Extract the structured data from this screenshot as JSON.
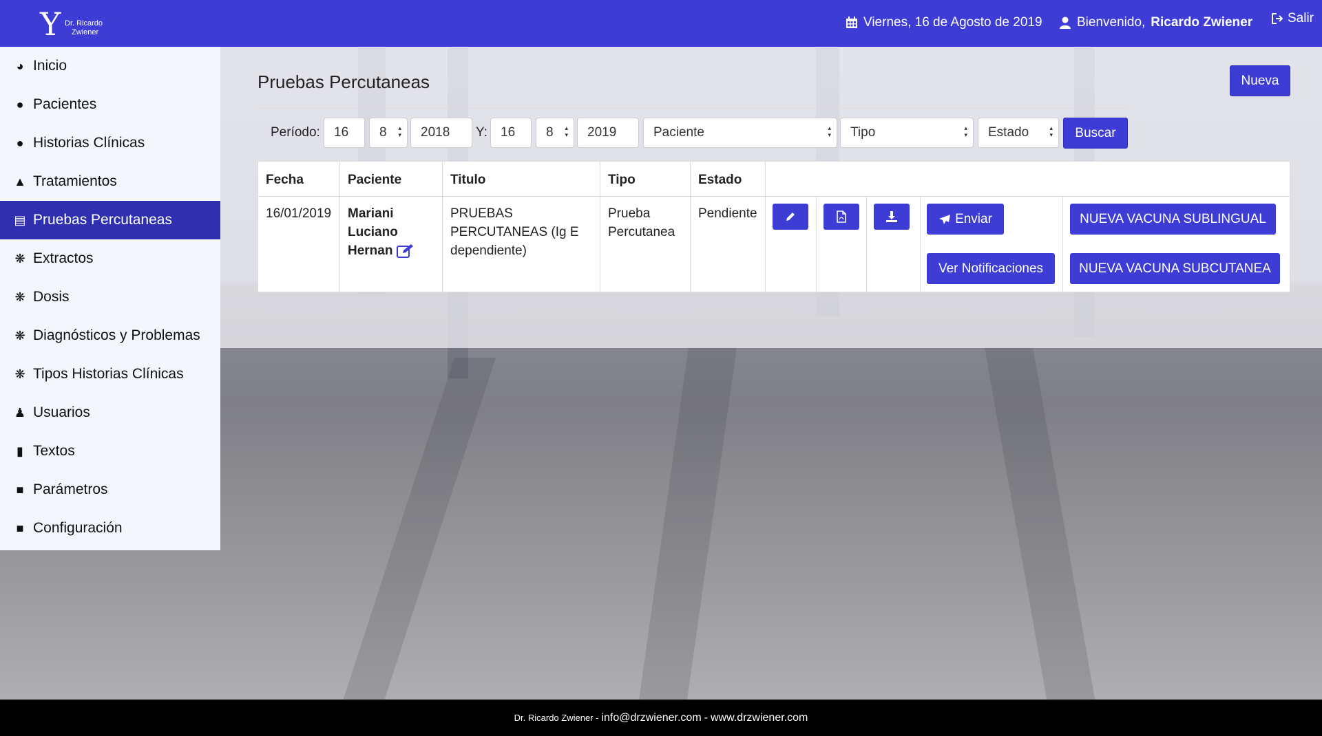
{
  "header": {
    "logo_text_1": "Dr. Ricardo",
    "logo_text_2": "Zwiener",
    "date": "Viernes, 16 de Agosto de 2019",
    "welcome_label": "Bienvenido,",
    "user_name": "Ricardo Zwiener",
    "exit_label": "Salir"
  },
  "sidebar": {
    "items": [
      {
        "label": "Inicio",
        "icon": "dashboard-icon"
      },
      {
        "label": "Pacientes",
        "icon": "users-icon"
      },
      {
        "label": "Historias Clínicas",
        "icon": "users-icon"
      },
      {
        "label": "Tratamientos",
        "icon": "drop-icon"
      },
      {
        "label": "Pruebas Percutaneas",
        "icon": "document-icon"
      },
      {
        "label": "Extractos",
        "icon": "bug-icon"
      },
      {
        "label": "Dosis",
        "icon": "bug-icon"
      },
      {
        "label": "Diagnósticos y Problemas",
        "icon": "bug-icon"
      },
      {
        "label": "Tipos Historias Clínicas",
        "icon": "bug-icon"
      },
      {
        "label": "Usuarios",
        "icon": "user-secret-icon"
      },
      {
        "label": "Textos",
        "icon": "file-icon"
      },
      {
        "label": "Parámetros",
        "icon": "lock-icon"
      },
      {
        "label": "Configuración",
        "icon": "lock-icon"
      }
    ],
    "active_index": 4
  },
  "page": {
    "title": "Pruebas Percutaneas",
    "new_button": "Nueva"
  },
  "filters": {
    "period_label": "Período:",
    "from_day": "16",
    "from_month": "8",
    "from_year": "2018",
    "and_label": "Y:",
    "to_day": "16",
    "to_month": "8",
    "to_year": "2019",
    "patient": "Paciente",
    "type": "Tipo",
    "status": "Estado",
    "search_button": "Buscar"
  },
  "table": {
    "headers": [
      "Fecha",
      "Paciente",
      "Titulo",
      "Tipo",
      "Estado"
    ],
    "rows": [
      {
        "date": "16/01/2019",
        "patient_line1": "Mariani",
        "patient_line2": "Luciano",
        "patient_line3": "Hernan",
        "title_line1": "PRUEBAS",
        "title_line2": "PERCUTANEAS (Ig E",
        "title_line3": "dependiente)",
        "type_line1": "Prueba",
        "type_line2": "Percutanea",
        "status": "Pendiente",
        "send_button": "Enviar",
        "notifications_button": "Ver Notificaciones",
        "sublingual_button": "NUEVA VACUNA SUBLINGUAL",
        "subcutaneous_button": "NUEVA VACUNA SUBCUTANEA"
      }
    ]
  },
  "footer": {
    "name": "Dr. Ricardo Zwiener -",
    "email": "info@drzwiener.com",
    "sep": "-",
    "site": "www.drzwiener.com"
  },
  "colors": {
    "primary": "#3d3dd6",
    "sidebar_active": "#2f2fb0",
    "sidebar_bg": "#f4f6ff",
    "footer_bg": "#000000"
  }
}
